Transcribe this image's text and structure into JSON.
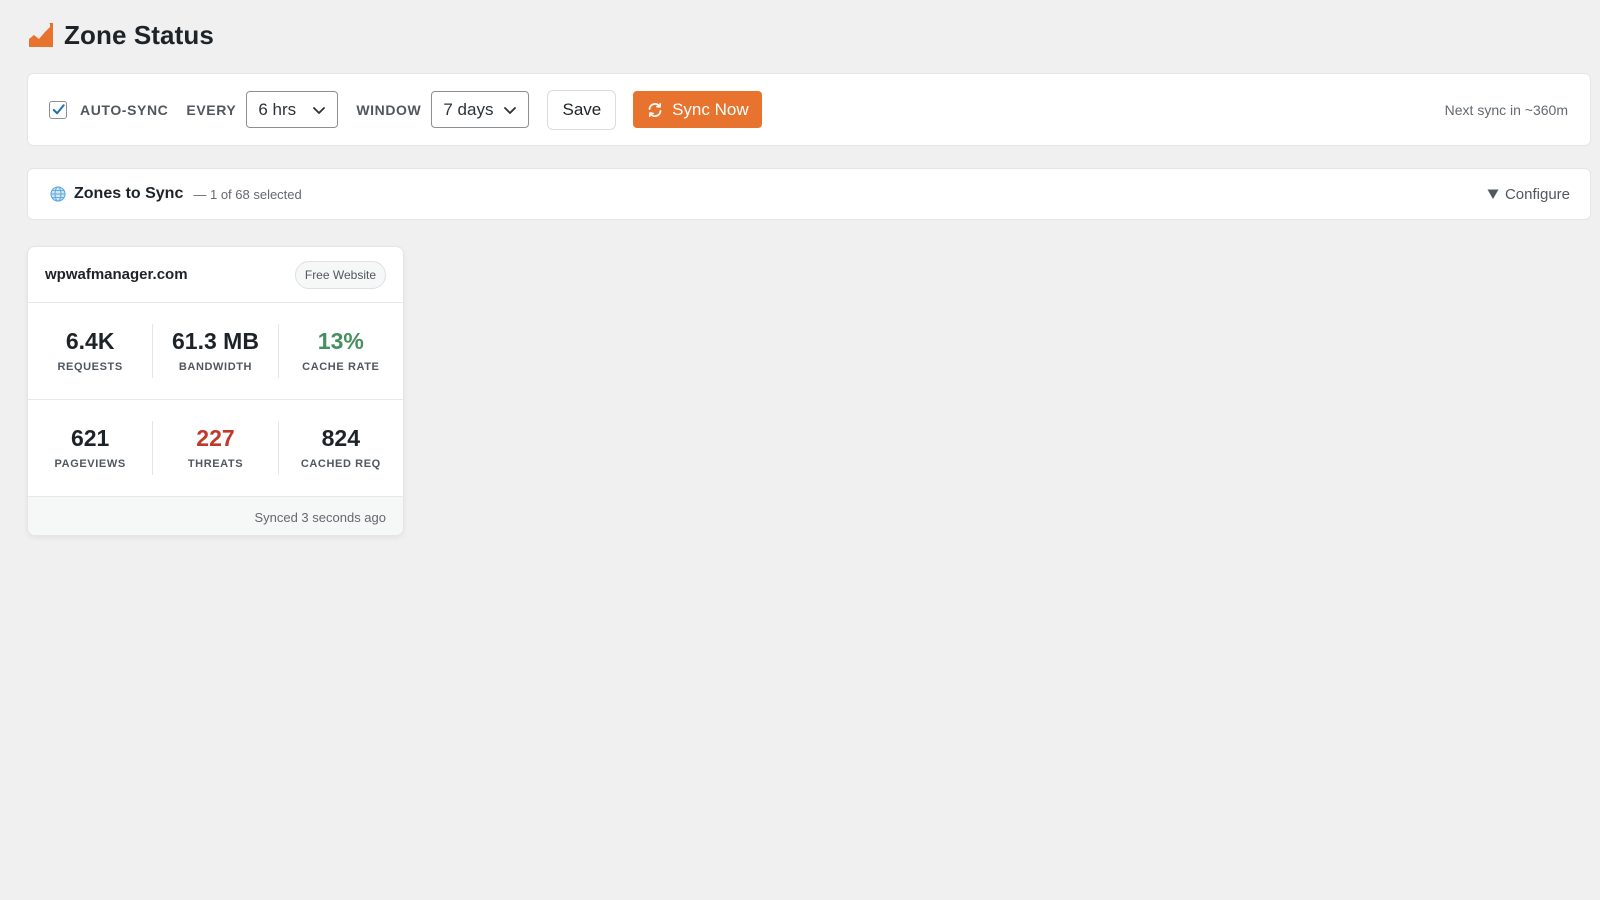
{
  "page": {
    "title": "Zone Status",
    "title_icon": "chart-growth-icon",
    "accent_color": "#e8732e"
  },
  "sync_bar": {
    "auto_sync_checked": true,
    "auto_sync_label": "AUTO-SYNC",
    "every_label": "EVERY",
    "every_value": "6 hrs",
    "window_label": "WINDOW",
    "window_value": "7 days",
    "save_label": "Save",
    "sync_now_label": "Sync Now",
    "sync_now_icon": "refresh-icon",
    "next_sync_text": "Next sync in ~360m"
  },
  "zones_bar": {
    "icon": "globe-icon",
    "title": "Zones to Sync",
    "count_text": "— 1 of 68 selected",
    "configure_label": "Configure",
    "configure_icon": "triangle-down-icon"
  },
  "zone_card": {
    "name": "wpwafmanager.com",
    "plan": "Free Website",
    "stats_row1": [
      {
        "value": "6.4K",
        "label": "REQUESTS",
        "color": "#1d2327"
      },
      {
        "value": "61.3 MB",
        "label": "BANDWIDTH",
        "color": "#1d2327"
      },
      {
        "value": "13%",
        "label": "CACHE RATE",
        "color": "#46905f"
      }
    ],
    "stats_row2": [
      {
        "value": "621",
        "label": "PAGEVIEWS",
        "color": "#1d2327"
      },
      {
        "value": "227",
        "label": "THREATS",
        "color": "#c0392b"
      },
      {
        "value": "824",
        "label": "CACHED REQ",
        "color": "#1d2327"
      }
    ],
    "footer_text": "Synced 3 seconds ago"
  }
}
